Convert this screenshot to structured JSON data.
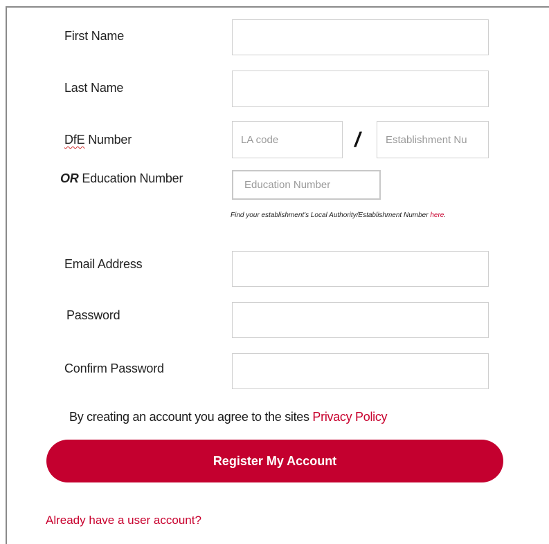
{
  "form": {
    "first_name": {
      "label": "First Name",
      "value": ""
    },
    "last_name": {
      "label": "Last Name",
      "value": ""
    },
    "dfe_number": {
      "label_word": "DfE",
      "label_rest": " Number",
      "la_code_placeholder": "LA code",
      "separator": "/",
      "establishment_placeholder": "Establishment Nu"
    },
    "education_number": {
      "or_prefix": "OR",
      "label_rest": " Education Number",
      "placeholder": "Education Number"
    },
    "hint": {
      "text": "Find your establishment's Local Authority/Establishment Number ",
      "link": "here",
      "suffix": "."
    },
    "email": {
      "label": "Email Address",
      "value": ""
    },
    "password": {
      "label": "Password",
      "value": ""
    },
    "confirm_password": {
      "label": "Confirm Password",
      "value": ""
    }
  },
  "agreement": {
    "text": "By creating an account you agree to the sites ",
    "link": "Privacy Policy"
  },
  "register_button": {
    "label": "Register My Account"
  },
  "login_link": {
    "label": "Already have a user account?"
  },
  "colors": {
    "accent": "#c4002f",
    "link": "#c8002d",
    "input_border": "#cfcfcf"
  }
}
